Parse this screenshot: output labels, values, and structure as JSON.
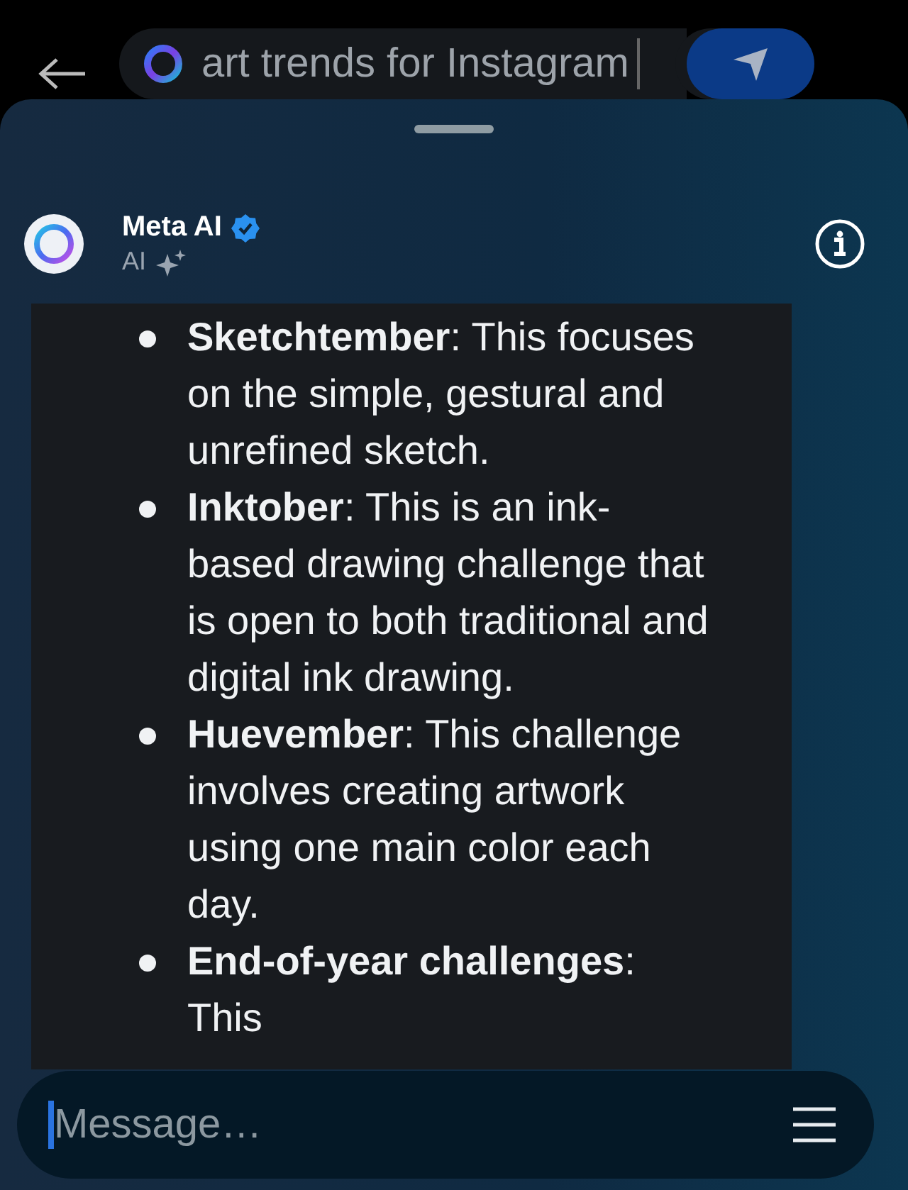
{
  "search": {
    "value": "art trends for Instagram"
  },
  "chat": {
    "name": "Meta AI",
    "verified": true,
    "subtitle": "AI"
  },
  "message_items": [
    {
      "text": "**Sketchtember**: This focuses on the simple, gestural and unrefined sketch."
    },
    {
      "text": "**Inktober**: This is an ink-based drawing challenge that is open to both traditional and digital ink drawing."
    },
    {
      "text": "**Huevember**: This challenge involves creating artwork using one main color each day."
    },
    {
      "text": "**End-of-year challenges**: This"
    }
  ],
  "composer": {
    "placeholder": "Message…"
  }
}
